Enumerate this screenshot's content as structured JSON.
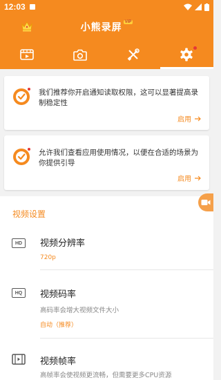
{
  "status_bar": {
    "time": "12:03"
  },
  "header": {
    "title": "小熊录屏",
    "vip": "VIP"
  },
  "tabs": [
    {
      "name": "videos"
    },
    {
      "name": "screenshots"
    },
    {
      "name": "tools"
    },
    {
      "name": "settings",
      "active": true
    }
  ],
  "cards": [
    {
      "text": "我们推荐你开启通知读取权限，这可以显著提高录制稳定性",
      "action": "启用"
    },
    {
      "text": "允许我们查看应用使用情况，以便在合适的场景为你提供引导",
      "action": "启用"
    }
  ],
  "settings": {
    "section_title": "视频设置",
    "items": [
      {
        "icon_label": "HD",
        "title": "视频分辨率",
        "value": "720p"
      },
      {
        "icon_label": "HQ",
        "title": "视频码率",
        "description": "高码率会增大视频文件大小",
        "value": "自动（推荐）"
      },
      {
        "title": "视频帧率",
        "description": "高帧率会使视频更流畅，但需要更多CPU资源"
      }
    ]
  },
  "colors": {
    "primary": "#f58a1f",
    "badge_red": "#e53935"
  }
}
